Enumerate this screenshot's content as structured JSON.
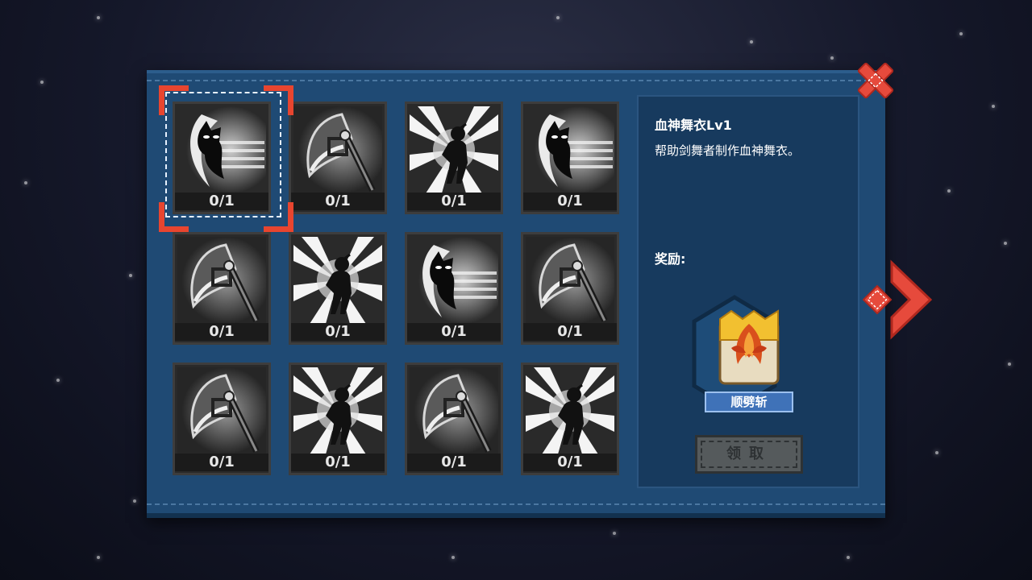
{
  "collection": {
    "slots": [
      {
        "count": "0/1",
        "icon": "shadow-imp-icon"
      },
      {
        "count": "0/1",
        "icon": "axe-weapon-icon"
      },
      {
        "count": "0/1",
        "icon": "radiant-figure-icon"
      },
      {
        "count": "0/1",
        "icon": "shadow-imp-icon"
      },
      {
        "count": "0/1",
        "icon": "axe-weapon-icon"
      },
      {
        "count": "0/1",
        "icon": "radiant-figure-icon"
      },
      {
        "count": "0/1",
        "icon": "shadow-imp-icon"
      },
      {
        "count": "0/1",
        "icon": "axe-weapon-icon"
      },
      {
        "count": "0/1",
        "icon": "axe-weapon-icon"
      },
      {
        "count": "0/1",
        "icon": "radiant-figure-icon"
      },
      {
        "count": "0/1",
        "icon": "axe-weapon-icon"
      },
      {
        "count": "0/1",
        "icon": "radiant-figure-icon"
      }
    ],
    "selected_index": 0
  },
  "info": {
    "title": "血神舞衣Lv1",
    "description": "帮助剑舞者制作血神舞衣。",
    "reward_label": "奖励:",
    "reward_name": "顺劈斩",
    "claim_label": "领取"
  },
  "colors": {
    "accent": "#e8452f",
    "panel": "#1f4a74",
    "info_bg": "#173a5e"
  }
}
